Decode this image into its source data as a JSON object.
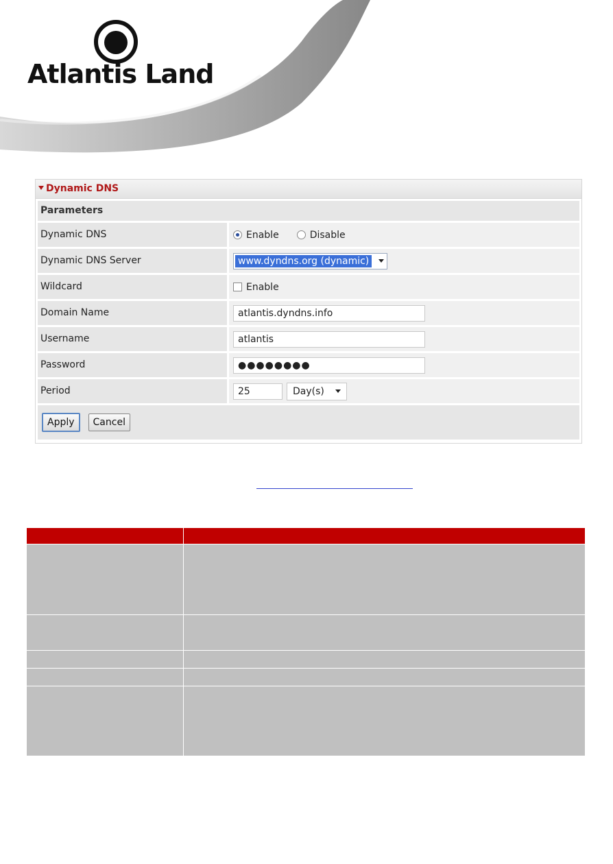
{
  "brand": {
    "name": "Atlantis Land"
  },
  "panel": {
    "title": "Dynamic DNS",
    "section": "Parameters",
    "fields": {
      "dynamic_dns": {
        "label": "Dynamic DNS",
        "enable": "Enable",
        "disable": "Disable",
        "selected": "Enable"
      },
      "server": {
        "label": "Dynamic DNS Server",
        "value": "www.dyndns.org (dynamic)"
      },
      "wildcard": {
        "label": "Wildcard",
        "option": "Enable",
        "checked": false
      },
      "domain": {
        "label": "Domain Name",
        "value": "atlantis.dyndns.info"
      },
      "username": {
        "label": "Username",
        "value": "atlantis"
      },
      "password": {
        "label": "Password",
        "value": "●●●●●●●●"
      },
      "period": {
        "label": "Period",
        "value": "25",
        "unit": "Day(s)"
      }
    },
    "buttons": {
      "apply": "Apply",
      "cancel": "Cancel"
    }
  },
  "colors": {
    "accent": "#b01818",
    "table_header": "#c00000",
    "table_cell": "#c0c0c0"
  }
}
